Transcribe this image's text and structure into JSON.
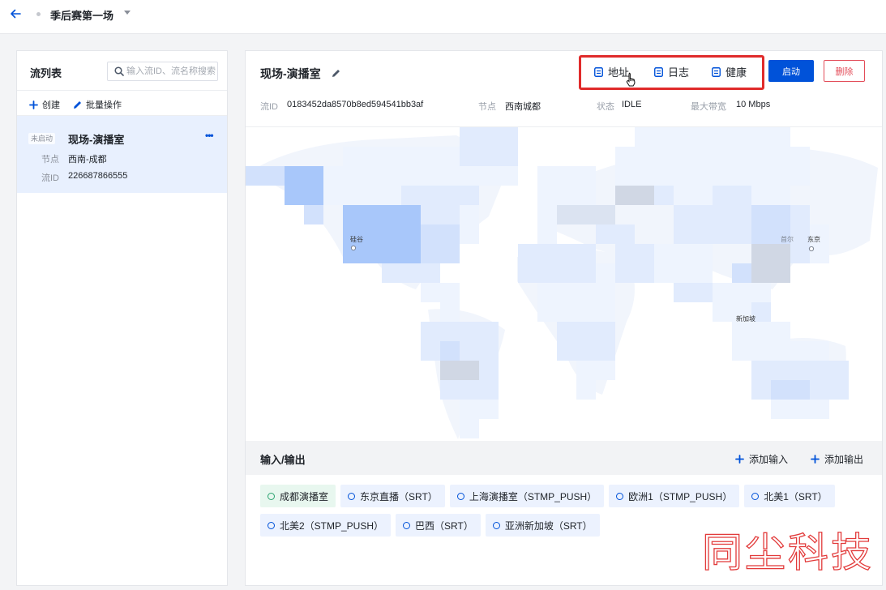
{
  "colors": {
    "accent": "#0052d9",
    "highlight_border": "#e02b2b",
    "danger": "#e34d59",
    "success": "#2ba471",
    "selected_bg": "#e8f0fe",
    "map_highlight": "#a8c7fa"
  },
  "icons": {
    "back": "arrow-left-icon",
    "title_dropdown": "caret-down-icon",
    "search": "search-icon",
    "create": "plus-icon",
    "batch": "pencil-icon",
    "edit_title": "pencil-icon",
    "doc": "document-icon",
    "cursor": "pointer-cursor-icon",
    "io_item": "circle-icon"
  },
  "topbar": {
    "title": "季后赛第一场"
  },
  "stream_list": {
    "title": "流列表",
    "search_placeholder": "输入流ID、流名称搜索",
    "create_label": "创建",
    "batch_label": "批量操作",
    "items": [
      {
        "status": "未启动",
        "name": "现场-演播室",
        "more": "•••",
        "node_label": "节点",
        "node": "西南-成都",
        "id_label": "流ID",
        "id": "226687866555",
        "selected": true
      }
    ]
  },
  "detail": {
    "title": "现场-演播室",
    "actions": {
      "address": "地址",
      "log": "日志",
      "health": "健康",
      "start": "启动",
      "delete": "删除"
    },
    "info": {
      "id_label": "流ID",
      "id": "0183452da8570b8ed594541bb3af",
      "node_label": "节点",
      "node": "西南城都",
      "status_label": "状态",
      "status": "IDLE",
      "bandwidth_label": "最大带宽",
      "bandwidth": "10 Mbps"
    },
    "map": {
      "cities": [
        "硅谷",
        "首尔",
        "东京",
        "新加坡"
      ]
    }
  },
  "io": {
    "title": "输入/输出",
    "add_input": "添加输入",
    "add_output": "添加输出",
    "tags": [
      {
        "label": "成都演播室",
        "state": "active"
      },
      {
        "label": "东京直播（SRT）",
        "state": "idle"
      },
      {
        "label": "上海演播室（STMP_PUSH）",
        "state": "idle"
      },
      {
        "label": "欧洲1（STMP_PUSH）",
        "state": "idle"
      },
      {
        "label": "北美1（SRT）",
        "state": "idle"
      },
      {
        "label": "北美2（STMP_PUSH）",
        "state": "idle"
      },
      {
        "label": "巴西（SRT）",
        "state": "idle"
      },
      {
        "label": "亚洲新加坡（SRT）",
        "state": "idle"
      }
    ]
  },
  "watermark": "同尘科技"
}
